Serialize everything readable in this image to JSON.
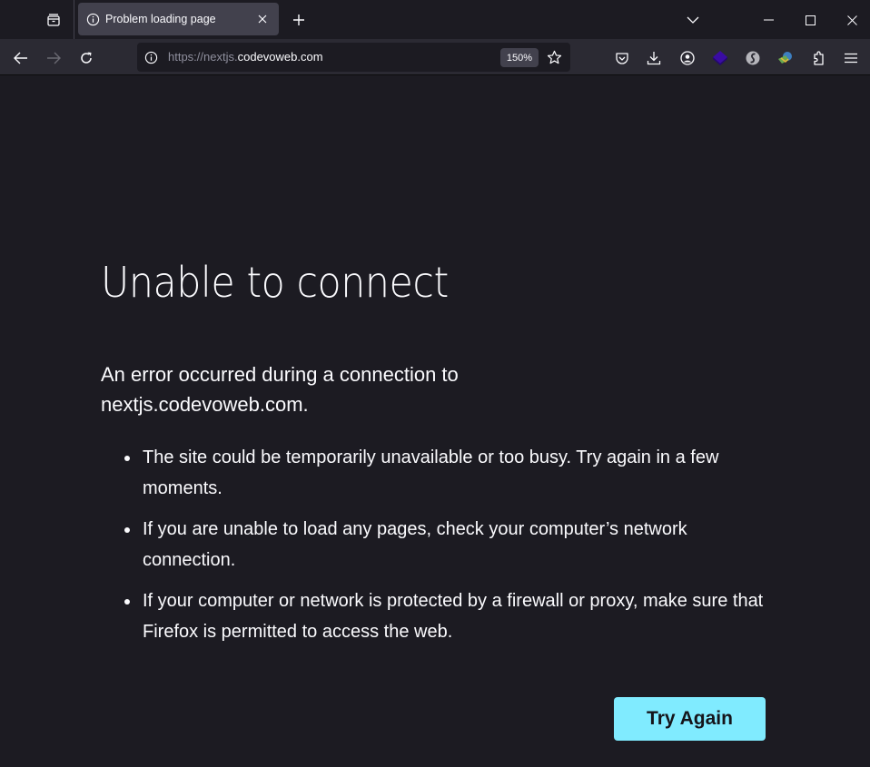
{
  "tabbar": {
    "tab_title": "Problem loading page",
    "icons": [
      "firefox-view-icon",
      "info-icon",
      "close-tab-icon",
      "new-tab-icon",
      "list-all-tabs-icon",
      "minimize-icon",
      "maximize-icon",
      "window-close-icon"
    ]
  },
  "navbar": {
    "url_scheme": "https://",
    "url_subdomain": "nextjs.",
    "url_host": "codevoweb.com",
    "zoom_level": "150%",
    "icons": [
      "back-icon",
      "forward-icon",
      "reload-icon",
      "site-info-icon",
      "bookmark-star-icon",
      "pocket-icon",
      "downloads-icon",
      "account-icon",
      "extension-purple-cube-icon",
      "extension-s-icon",
      "extension-idm-icon",
      "extensions-puzzle-icon",
      "menu-hamburger-icon"
    ]
  },
  "error_page": {
    "title": "Unable to connect",
    "description": "An error occurred during a connection to nextjs.codevoweb.com.",
    "bullets": [
      "The site could be temporarily unavailable or too busy. Try again in a few moments.",
      "If you are unable to load any pages, check your computer’s network connection.",
      "If your computer or network is protected by a firewall or proxy, make sure that Firefox is permitted to access the web."
    ],
    "try_again_label": "Try Again"
  },
  "colors": {
    "background": "#1c1b22",
    "toolbar": "#2b2a33",
    "tab_selected": "#42414d",
    "button_accent": "#80ebff",
    "text": "#fbfbfe"
  }
}
